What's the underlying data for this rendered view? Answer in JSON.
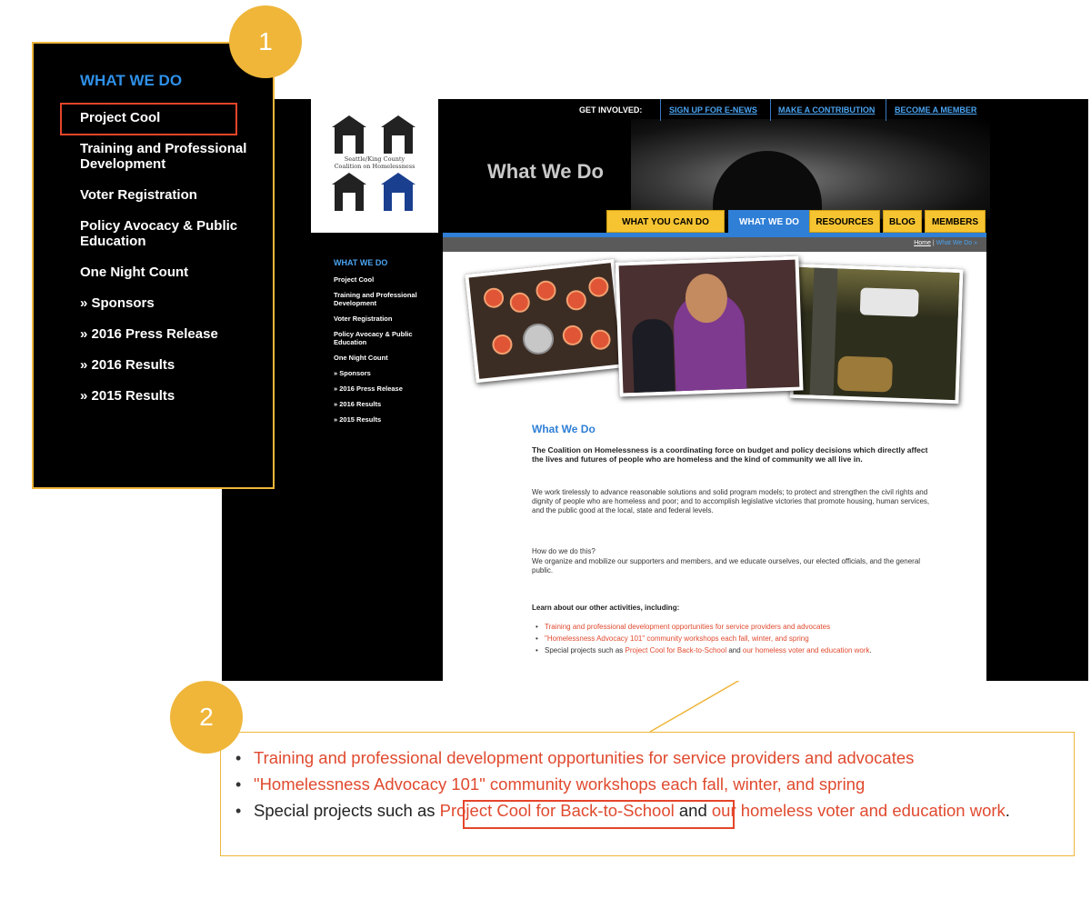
{
  "site": {
    "logo_text": [
      "Seattle/King County",
      "Coalition on Homelessness"
    ],
    "get_involved_label": "GET INVOLVED:",
    "top_links": [
      "SIGN UP FOR E-NEWS",
      "MAKE A CONTRIBUTION",
      "BECOME A MEMBER"
    ],
    "page_title": "What We Do",
    "main_tabs": [
      "WHAT YOU CAN DO",
      "WHAT WE DO",
      "RESOURCES",
      "BLOG",
      "MEMBERS"
    ],
    "active_tab": "WHAT WE DO",
    "breadcrumb": {
      "home": "Home",
      "separator": "|",
      "current": "What We Do »"
    },
    "side_nav": {
      "title": "WHAT WE DO",
      "items": [
        "Project Cool",
        "Training and Professional Development",
        "Voter Registration",
        "Policy Avocacy & Public Education",
        "One Night Count",
        "» Sponsors",
        "» 2016 Press Release",
        "» 2016 Results",
        "» 2015 Results"
      ]
    },
    "content": {
      "title": "What We Do",
      "intro_bold": "The Coalition on Homelessness is a coordinating force on budget and policy decisions which directly affect the lives and futures of people who are homeless and the kind of community we all live in.",
      "para1": "We work tirelessly to advance reasonable solutions and solid program models; to protect and strengthen the civil rights and dignity of people who are homeless and poor; and to accomplish legislative victories that promote housing, human services, and the public good at the local, state and federal levels.",
      "para2_question": "How do we do this?",
      "para2": "We organize and mobilize our supporters and members, and we educate ourselves, our elected officials, and the general public.",
      "learn_heading": "Learn about our other activities, including:",
      "activities": {
        "item1": "Training and professional development opportunities for service providers and advocates",
        "item2": "\"Homelessness Advocacy 101\" community workshops each fall, winter, and spring",
        "item3_prefix": "Special projects such as ",
        "item3_link1": "Project Cool for Back-to-School",
        "item3_mid": " and ",
        "item3_link2": "our homeless voter and education work",
        "item3_suffix": "."
      }
    }
  },
  "callout1": {
    "badge": "1",
    "title": "WHAT WE DO",
    "items": [
      "Project Cool",
      "Training and Professional Development",
      "Voter Registration",
      "Policy Avocacy & Public Education",
      "One Night Count",
      "» Sponsors",
      "» 2016 Press Release",
      "» 2016 Results",
      "» 2015 Results"
    ],
    "highlighted_item": "Project Cool"
  },
  "callout2": {
    "badge": "2",
    "highlighted_link": "Project Cool for Back-to-School"
  },
  "colors": {
    "accent_blue": "#2f7fd6",
    "tab_yellow": "#f6c431",
    "link_red": "#e04a2f",
    "callout_gold": "#efb63a",
    "highlight_red": "#e5452a"
  }
}
